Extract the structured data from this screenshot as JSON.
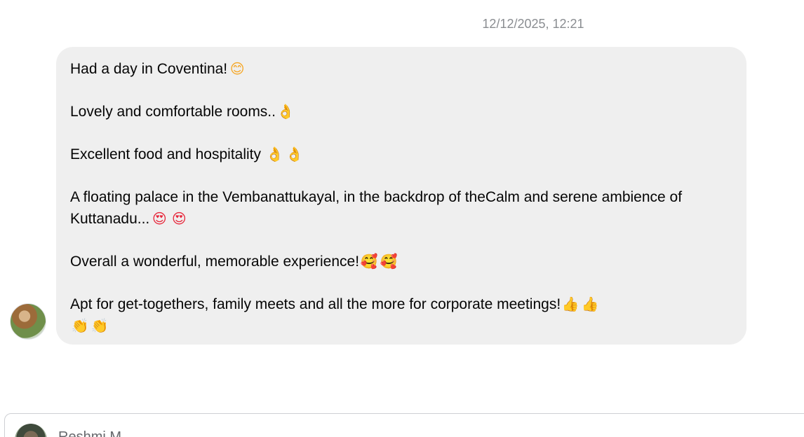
{
  "thread": {
    "timestamp": "12/12/2025, 12:21"
  },
  "message": {
    "lines": [
      {
        "text": "Had a day in Coventina!",
        "emojis": [
          "😊"
        ]
      },
      {
        "text": "Lovely and comfortable rooms..",
        "emojis": [
          "👌"
        ]
      },
      {
        "text": "Excellent food and hospitality ",
        "emojis": [
          "👌",
          "👌"
        ]
      },
      {
        "text": "A floating palace in the Vembanattukayal, in the backdrop of theCalm and serene ambience of Kuttanadu...",
        "emojis": [
          "😍",
          "😍"
        ]
      },
      {
        "text": "Overall a wonderful, memorable experience!",
        "emojis": [
          "🥰",
          "🥰"
        ]
      },
      {
        "text": "Apt for get-togethers, family meets and all the more for corporate meetings!",
        "emojis": [
          "👍",
          "👍",
          "👏",
          "👏"
        ]
      }
    ],
    "sender_avatar": "user-avatar"
  },
  "composer": {
    "name_partial": "Reshmi M"
  }
}
